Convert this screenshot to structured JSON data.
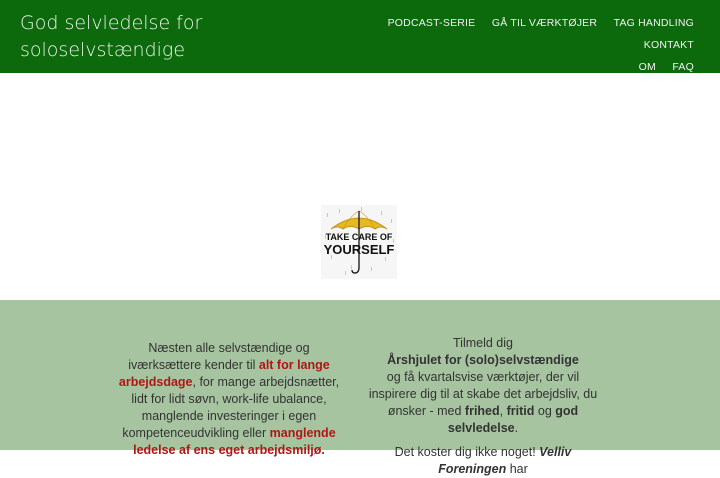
{
  "header": {
    "brand": "God selvledelse for soloselvstændige",
    "nav": [
      "PODCAST-SERIE",
      "GÅ TIL VÆRKTØJER",
      "TAG HANDLING",
      "KONTAKT",
      "OM",
      "FAQ"
    ]
  },
  "hero": {
    "image_text_1": "TAKE CARE OF",
    "image_text_2": "YOURSELF"
  },
  "left": {
    "t1": "Næsten alle selvstændige og iværksættere kender til ",
    "r1": "alt for lange arbejdsdage",
    "t2": ", for mange arbejdsnætter, lidt for lidt søvn, work-life ubalance, manglende investeringer i egen kompetenceudvikling eller ",
    "r2": "manglende ledelse af ens eget arbejdsmiljø."
  },
  "right": {
    "line1": "Tilmeld dig",
    "line2": "Årshjulet for (solo)selvstændige",
    "line3": "og få kvartalsvise værktøjer, der vil inspirere dig til at skabe det arbejdsliv, du ønsker - med ",
    "b1": "frihed",
    "c1": ", ",
    "b2": "fritid",
    "c2": " og ",
    "b3": "god selvledelse",
    "dot": ".",
    "line4a": "Det koster dig ikke noget! ",
    "line4b": "Velliv Foreningen",
    "line4c": " har"
  },
  "colors": {
    "header_bg": "#0c6a0c",
    "green_section_bg": "#a7c4a0",
    "accent_red": "#b01616"
  }
}
